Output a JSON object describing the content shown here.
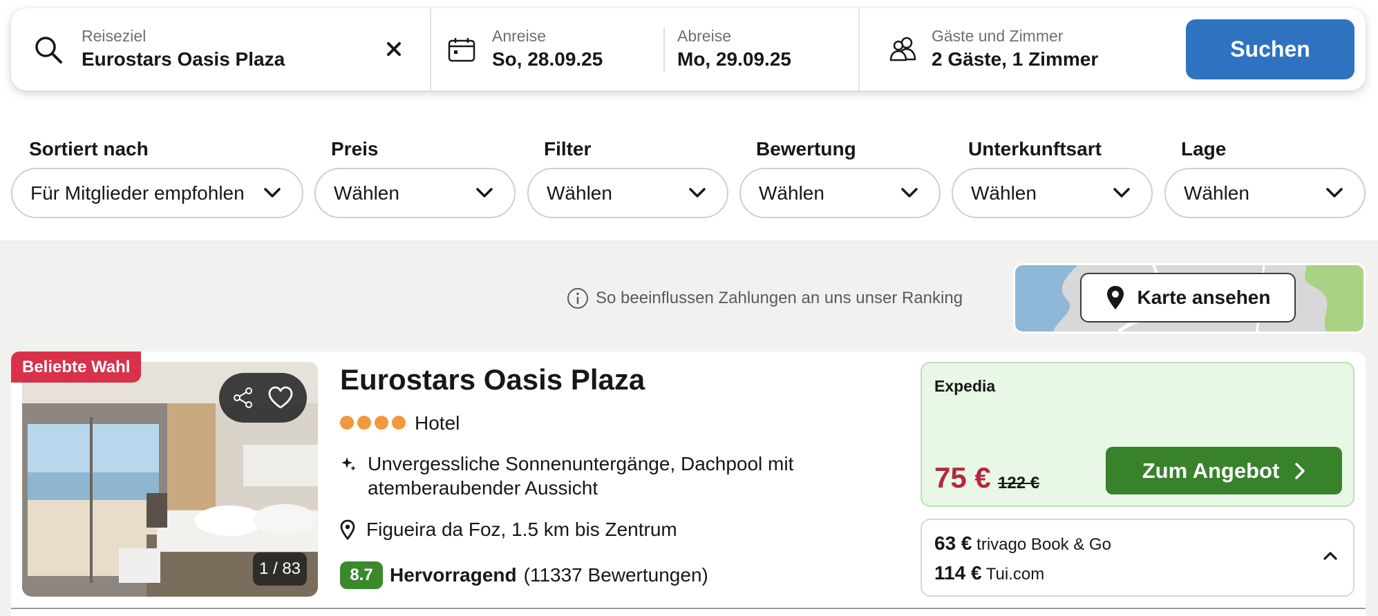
{
  "search": {
    "destination_label": "Reiseziel",
    "destination_value": "Eurostars Oasis Plaza",
    "checkin_label": "Anreise",
    "checkin_value": "So, 28.09.25",
    "checkout_label": "Abreise",
    "checkout_value": "Mo, 29.09.25",
    "guests_label": "Gäste und Zimmer",
    "guests_value": "2 Gäste, 1 Zimmer",
    "search_button": "Suchen"
  },
  "filters": [
    {
      "label": "Sortiert nach",
      "value": "Für Mitglieder empfohlen"
    },
    {
      "label": "Preis",
      "value": "Wählen"
    },
    {
      "label": "Filter",
      "value": "Wählen"
    },
    {
      "label": "Bewertung",
      "value": "Wählen"
    },
    {
      "label": "Unterkunftsart",
      "value": "Wählen"
    },
    {
      "label": "Lage",
      "value": "Wählen"
    }
  ],
  "ranking_info": "So beeinflussen Zahlungen an uns unser Ranking",
  "map_button": "Karte ansehen",
  "hotel": {
    "badge": "Beliebte Wahl",
    "name": "Eurostars Oasis Plaza",
    "stars": 4,
    "type": "Hotel",
    "highlight": "Unvergessliche Sonnenuntergänge, Dachpool mit atemberaubender Aussicht",
    "location": "Figueira da Foz, 1.5 km bis Zentrum",
    "photo_counter": "1 / 83",
    "rating_score": "8.7",
    "rating_label": "Hervorragend",
    "rating_count": "(11337 Bewertungen)"
  },
  "deal": {
    "partner": "Expedia",
    "price": "75 €",
    "old_price": "122 €",
    "button": "Zum Angebot"
  },
  "other_offers": [
    {
      "price": "63 €",
      "partner": "trivago Book & Go"
    },
    {
      "price": "114 €",
      "partner": "Tui.com"
    }
  ],
  "colors": {
    "accent_blue": "#2f73c0",
    "deal_green": "#37822b",
    "price_red": "#b6283c",
    "badge_red": "#d9314b",
    "star_orange": "#f2983d"
  }
}
